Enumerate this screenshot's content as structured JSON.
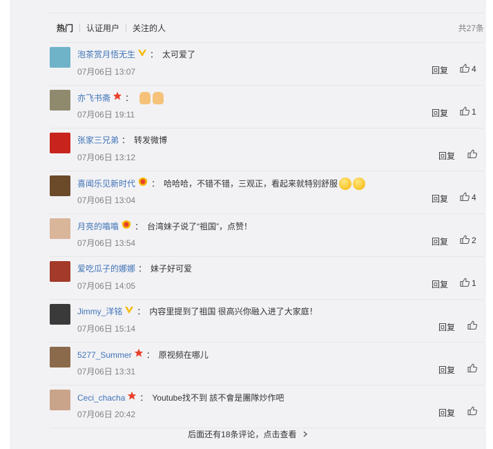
{
  "tabs": [
    {
      "label": "热门",
      "active": true
    },
    {
      "label": "认证用户",
      "active": false
    },
    {
      "label": "关注的人",
      "active": false
    }
  ],
  "total_label": "共27条",
  "reply_label": "回复",
  "comments": [
    {
      "user": "泡茶赏月悟无生",
      "badge": "vip-v-icon",
      "text": "太可爱了",
      "time": "07月06日 13:07",
      "likes": "4",
      "avatar_color": "#6fb3c8"
    },
    {
      "user": "亦飞书斋",
      "badge": "star-badge-icon",
      "text": "",
      "time": "07月06日 19:11",
      "likes": "1",
      "avatar_color": "#8f8a6e"
    },
    {
      "user": "张家三兄弟",
      "badge": "",
      "text": "转发微博",
      "time": "07月06日 13:12",
      "likes": "",
      "avatar_color": "#c8231d"
    },
    {
      "user": "喜闻乐见新时代",
      "badge": "gold-badge-icon",
      "text": "哈哈哈，不错不错，三观正，看起来就特别舒服",
      "time": "07月06日 13:04",
      "likes": "4",
      "avatar_color": "#6b4a2a"
    },
    {
      "user": "月亮的噏噏",
      "badge": "gold-badge-icon",
      "text": "台湾妹子说了“祖国”，点赞！",
      "time": "07月06日 13:54",
      "likes": "2",
      "avatar_color": "#d9b59a"
    },
    {
      "user": "爱吃瓜子的娜娜",
      "badge": "",
      "text": "妹子好可爱",
      "time": "07月06日 14:05",
      "likes": "1",
      "avatar_color": "#a33a2a"
    },
    {
      "user": "Jimmy_洋铭",
      "badge": "vip-v-icon",
      "text": "内容里提到了祖国 很高兴你融入进了大家庭！",
      "time": "07月06日 15:14",
      "likes": "",
      "avatar_color": "#3a3a3a"
    },
    {
      "user": "5277_Summer",
      "badge": "star-badge-icon",
      "text": "原视频在哪儿",
      "time": "07月06日 13:31",
      "likes": "",
      "avatar_color": "#8a6a4a"
    },
    {
      "user": "Ceci_chacha",
      "badge": "star-badge-icon",
      "text": "Youtube找不到 該不會是團隊炒作吧",
      "time": "07月06日 20:42",
      "likes": "",
      "avatar_color": "#c9a38a"
    }
  ],
  "footer_label": "后面还有18条评论，点击查看"
}
